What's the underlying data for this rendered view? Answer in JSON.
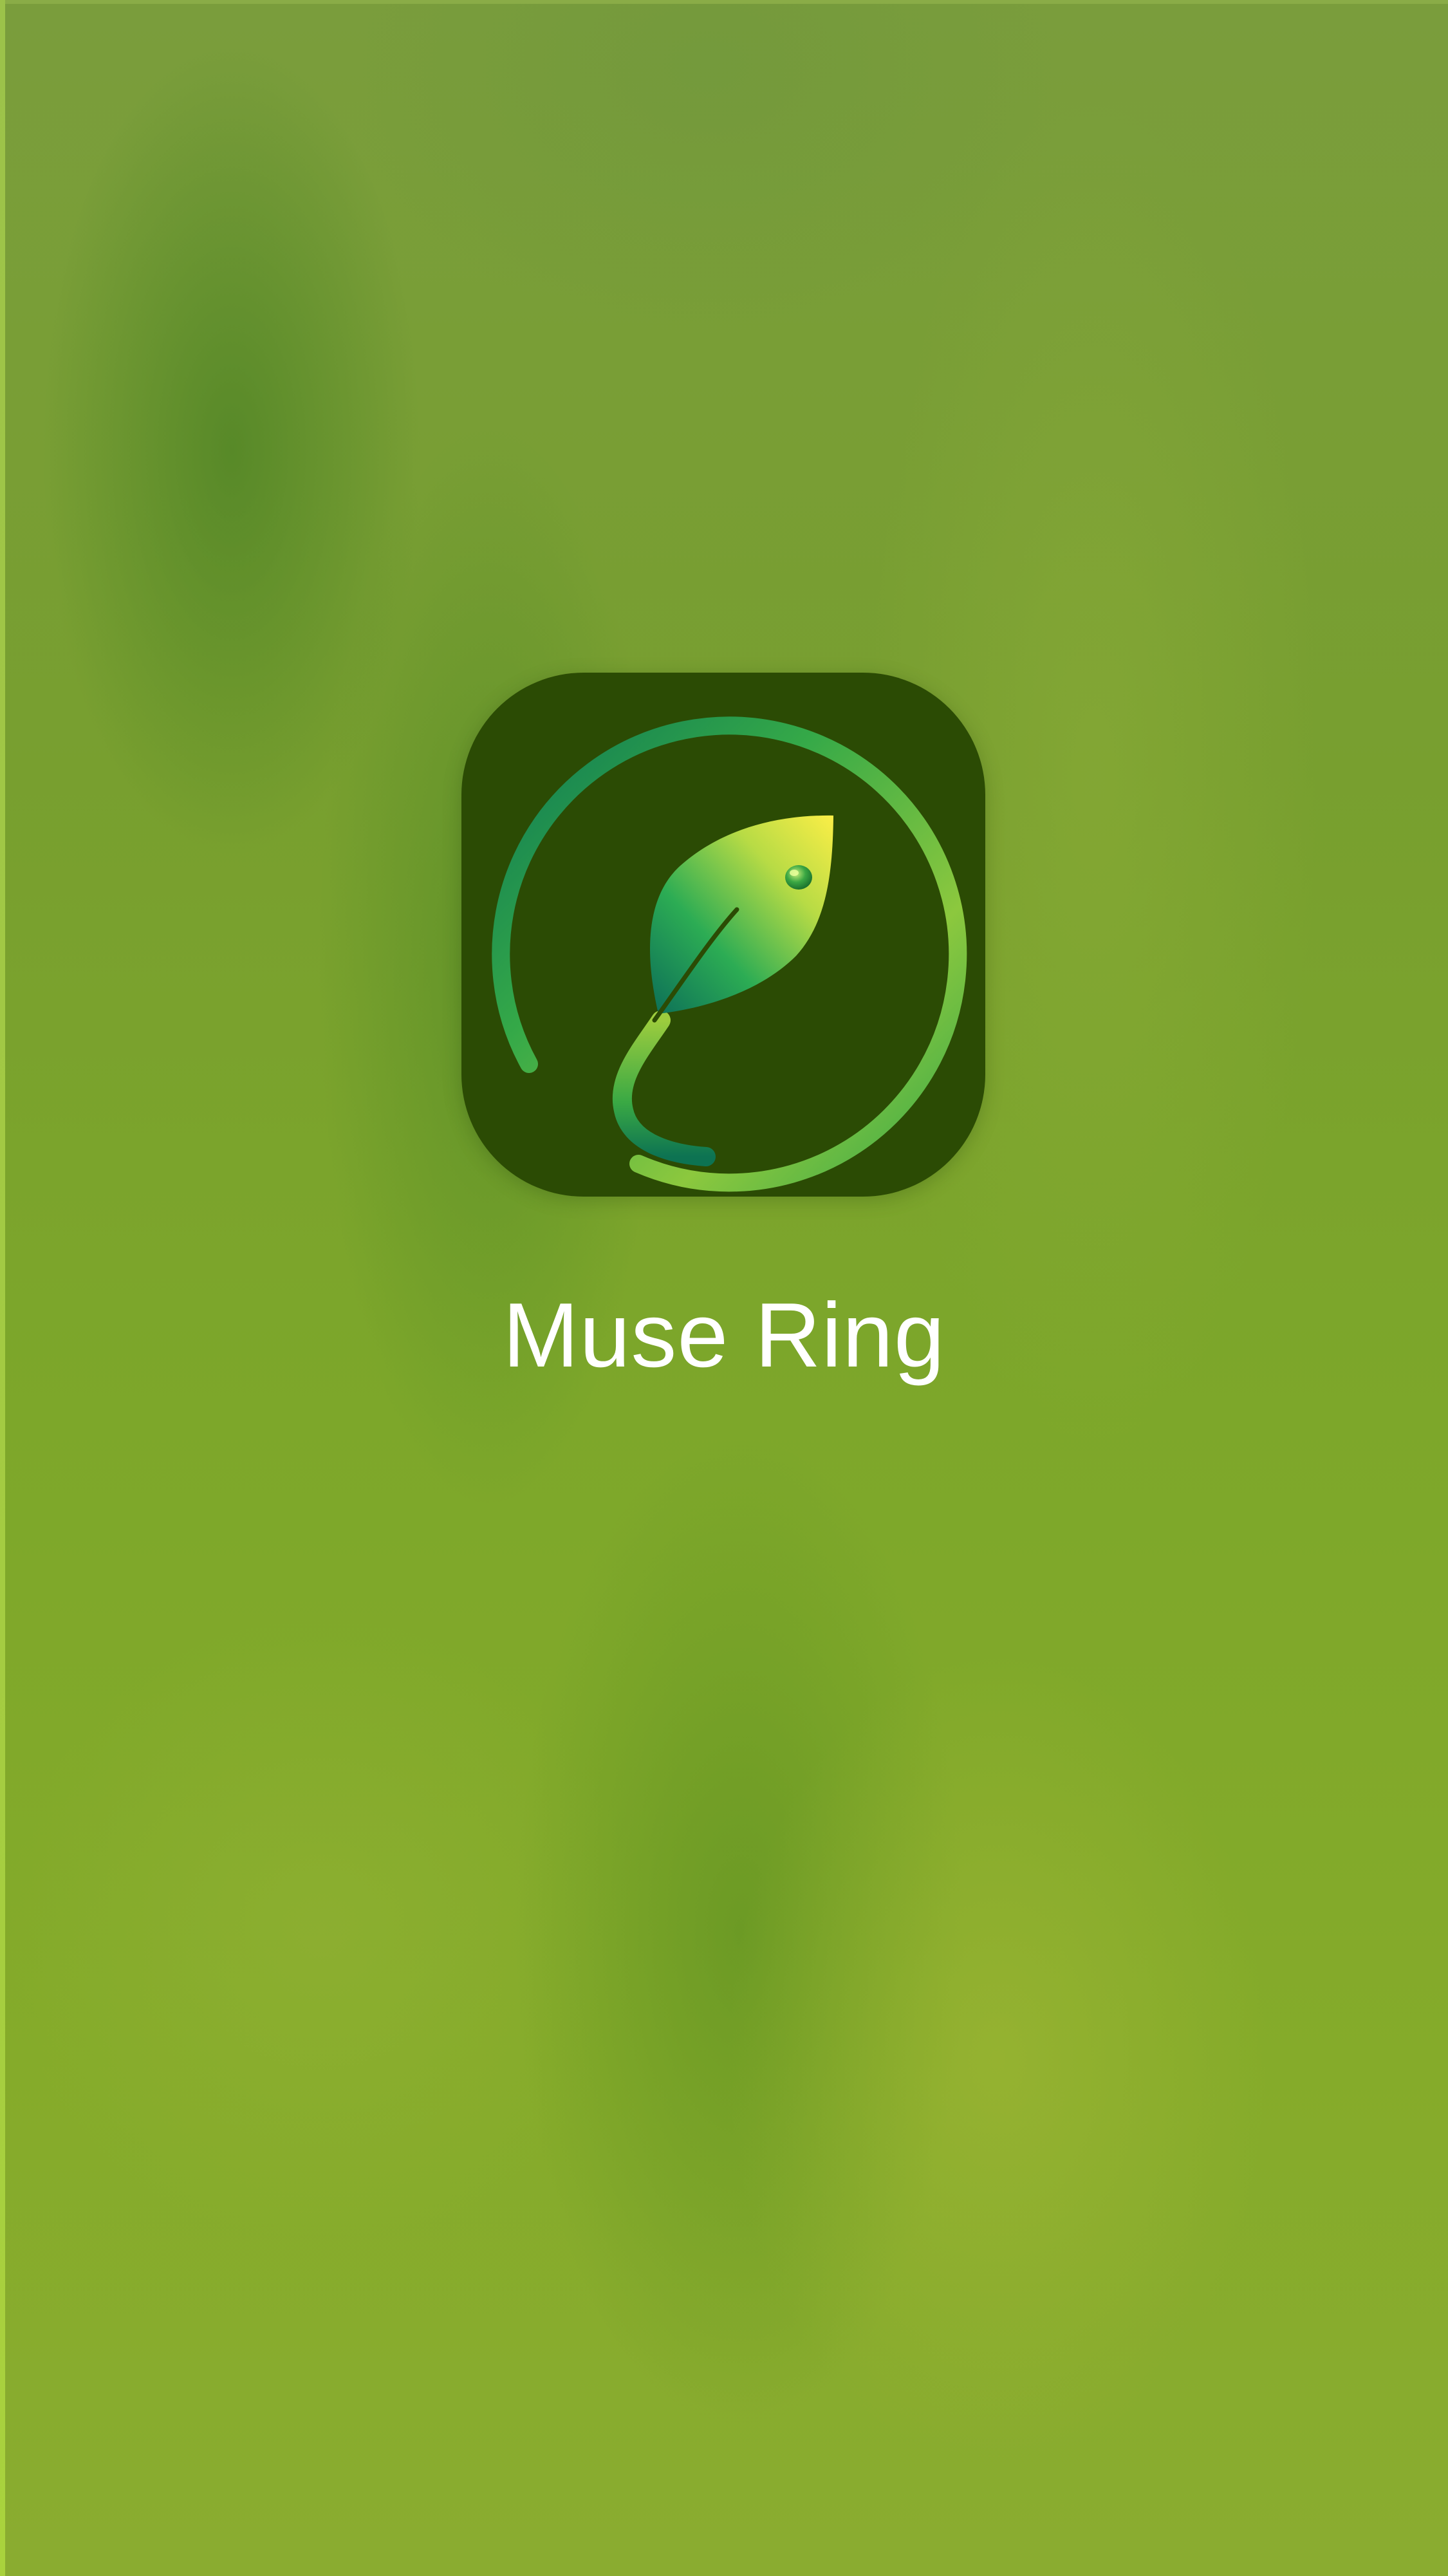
{
  "splash": {
    "app_name": "Muse Ring",
    "icon": "leaf-ring-logo-icon",
    "colors": {
      "background": "#7fa32c",
      "icon_background": "#2b4b04",
      "ring_green": "#3fae3c",
      "leaf_yellow": "#f3ec46",
      "leaf_teal": "#0f7a56",
      "title_text": "#ffffff"
    }
  }
}
